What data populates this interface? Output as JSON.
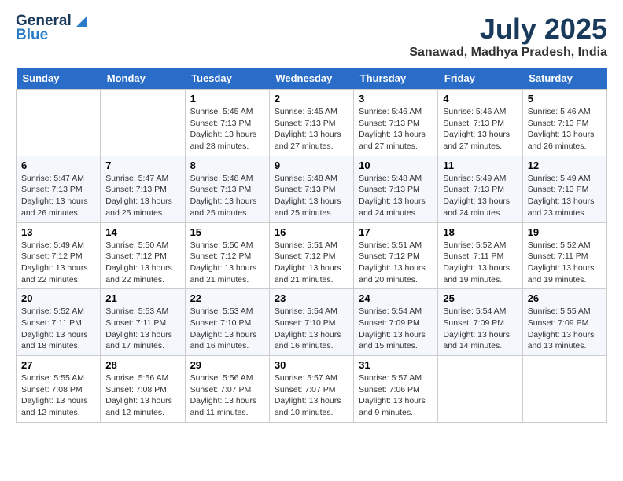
{
  "header": {
    "logo_general": "General",
    "logo_blue": "Blue",
    "month_title": "July 2025",
    "location": "Sanawad, Madhya Pradesh, India"
  },
  "calendar": {
    "days_of_week": [
      "Sunday",
      "Monday",
      "Tuesday",
      "Wednesday",
      "Thursday",
      "Friday",
      "Saturday"
    ],
    "weeks": [
      [
        {
          "day": "",
          "info": ""
        },
        {
          "day": "",
          "info": ""
        },
        {
          "day": "1",
          "info": "Sunrise: 5:45 AM\nSunset: 7:13 PM\nDaylight: 13 hours\nand 28 minutes."
        },
        {
          "day": "2",
          "info": "Sunrise: 5:45 AM\nSunset: 7:13 PM\nDaylight: 13 hours\nand 27 minutes."
        },
        {
          "day": "3",
          "info": "Sunrise: 5:46 AM\nSunset: 7:13 PM\nDaylight: 13 hours\nand 27 minutes."
        },
        {
          "day": "4",
          "info": "Sunrise: 5:46 AM\nSunset: 7:13 PM\nDaylight: 13 hours\nand 27 minutes."
        },
        {
          "day": "5",
          "info": "Sunrise: 5:46 AM\nSunset: 7:13 PM\nDaylight: 13 hours\nand 26 minutes."
        }
      ],
      [
        {
          "day": "6",
          "info": "Sunrise: 5:47 AM\nSunset: 7:13 PM\nDaylight: 13 hours\nand 26 minutes."
        },
        {
          "day": "7",
          "info": "Sunrise: 5:47 AM\nSunset: 7:13 PM\nDaylight: 13 hours\nand 25 minutes."
        },
        {
          "day": "8",
          "info": "Sunrise: 5:48 AM\nSunset: 7:13 PM\nDaylight: 13 hours\nand 25 minutes."
        },
        {
          "day": "9",
          "info": "Sunrise: 5:48 AM\nSunset: 7:13 PM\nDaylight: 13 hours\nand 25 minutes."
        },
        {
          "day": "10",
          "info": "Sunrise: 5:48 AM\nSunset: 7:13 PM\nDaylight: 13 hours\nand 24 minutes."
        },
        {
          "day": "11",
          "info": "Sunrise: 5:49 AM\nSunset: 7:13 PM\nDaylight: 13 hours\nand 24 minutes."
        },
        {
          "day": "12",
          "info": "Sunrise: 5:49 AM\nSunset: 7:13 PM\nDaylight: 13 hours\nand 23 minutes."
        }
      ],
      [
        {
          "day": "13",
          "info": "Sunrise: 5:49 AM\nSunset: 7:12 PM\nDaylight: 13 hours\nand 22 minutes."
        },
        {
          "day": "14",
          "info": "Sunrise: 5:50 AM\nSunset: 7:12 PM\nDaylight: 13 hours\nand 22 minutes."
        },
        {
          "day": "15",
          "info": "Sunrise: 5:50 AM\nSunset: 7:12 PM\nDaylight: 13 hours\nand 21 minutes."
        },
        {
          "day": "16",
          "info": "Sunrise: 5:51 AM\nSunset: 7:12 PM\nDaylight: 13 hours\nand 21 minutes."
        },
        {
          "day": "17",
          "info": "Sunrise: 5:51 AM\nSunset: 7:12 PM\nDaylight: 13 hours\nand 20 minutes."
        },
        {
          "day": "18",
          "info": "Sunrise: 5:52 AM\nSunset: 7:11 PM\nDaylight: 13 hours\nand 19 minutes."
        },
        {
          "day": "19",
          "info": "Sunrise: 5:52 AM\nSunset: 7:11 PM\nDaylight: 13 hours\nand 19 minutes."
        }
      ],
      [
        {
          "day": "20",
          "info": "Sunrise: 5:52 AM\nSunset: 7:11 PM\nDaylight: 13 hours\nand 18 minutes."
        },
        {
          "day": "21",
          "info": "Sunrise: 5:53 AM\nSunset: 7:11 PM\nDaylight: 13 hours\nand 17 minutes."
        },
        {
          "day": "22",
          "info": "Sunrise: 5:53 AM\nSunset: 7:10 PM\nDaylight: 13 hours\nand 16 minutes."
        },
        {
          "day": "23",
          "info": "Sunrise: 5:54 AM\nSunset: 7:10 PM\nDaylight: 13 hours\nand 16 minutes."
        },
        {
          "day": "24",
          "info": "Sunrise: 5:54 AM\nSunset: 7:09 PM\nDaylight: 13 hours\nand 15 minutes."
        },
        {
          "day": "25",
          "info": "Sunrise: 5:54 AM\nSunset: 7:09 PM\nDaylight: 13 hours\nand 14 minutes."
        },
        {
          "day": "26",
          "info": "Sunrise: 5:55 AM\nSunset: 7:09 PM\nDaylight: 13 hours\nand 13 minutes."
        }
      ],
      [
        {
          "day": "27",
          "info": "Sunrise: 5:55 AM\nSunset: 7:08 PM\nDaylight: 13 hours\nand 12 minutes."
        },
        {
          "day": "28",
          "info": "Sunrise: 5:56 AM\nSunset: 7:08 PM\nDaylight: 13 hours\nand 12 minutes."
        },
        {
          "day": "29",
          "info": "Sunrise: 5:56 AM\nSunset: 7:07 PM\nDaylight: 13 hours\nand 11 minutes."
        },
        {
          "day": "30",
          "info": "Sunrise: 5:57 AM\nSunset: 7:07 PM\nDaylight: 13 hours\nand 10 minutes."
        },
        {
          "day": "31",
          "info": "Sunrise: 5:57 AM\nSunset: 7:06 PM\nDaylight: 13 hours\nand 9 minutes."
        },
        {
          "day": "",
          "info": ""
        },
        {
          "day": "",
          "info": ""
        }
      ]
    ]
  }
}
